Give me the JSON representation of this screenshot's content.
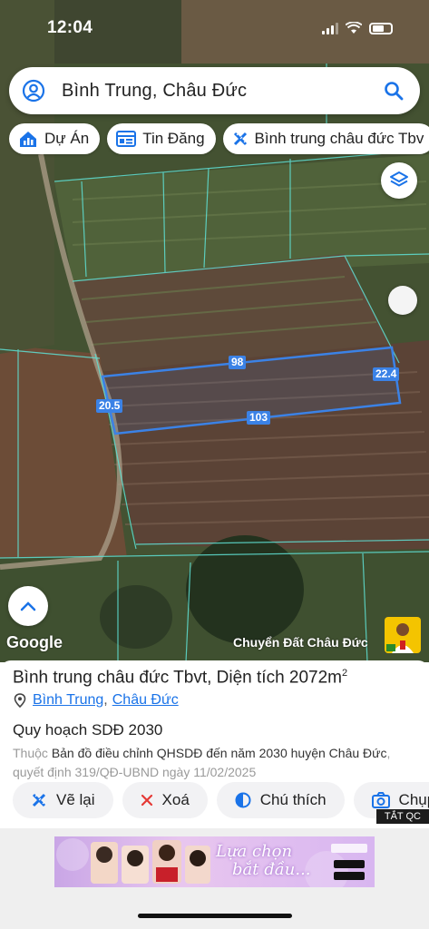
{
  "status": {
    "time": "12:04"
  },
  "search": {
    "query": "Bình Trung, Châu Đức"
  },
  "chips": [
    {
      "label": "Dự Án",
      "icon": "house-chart-icon"
    },
    {
      "label": "Tin Đăng",
      "icon": "listing-icon"
    },
    {
      "label": "Bình trung châu đức Tbv",
      "icon": "ruler-icon"
    }
  ],
  "map": {
    "google_label": "Google",
    "credit": "Chuyển Đất Châu Đức",
    "dimensions": {
      "top": "98",
      "right": "22.4",
      "left": "20.5",
      "bottom": "103"
    },
    "colors": {
      "parcel_outline": "#3b82e6",
      "boundary": "#5fe0d4"
    }
  },
  "parcel": {
    "title": "Bình trung châu đức Tbvt, Diện tích 2072m",
    "area_sup": "2",
    "ward": "Bình Trung",
    "separator": ",",
    "district": "Châu Đức"
  },
  "plan": {
    "title": "Quy hoạch SDĐ 2030",
    "prefix": "Thuộc",
    "map_name": "Bản đồ điều chỉnh QHSDĐ đến năm 2030 huyện Châu Đức",
    "decision": ", quyết định 319/QĐ-UBND ngày 11/02/2025"
  },
  "actions": [
    {
      "label": "Vẽ lại",
      "icon": "ruler-icon"
    },
    {
      "label": "Xoá",
      "icon": "close-icon"
    },
    {
      "label": "Chú thích",
      "icon": "half-circle-icon"
    },
    {
      "label": "Chụp",
      "icon": "camera-icon"
    }
  ],
  "ad": {
    "badge": "TẮT QC",
    "text_line1": "Lựa chọn",
    "text_line2": "bắt đầu..."
  }
}
